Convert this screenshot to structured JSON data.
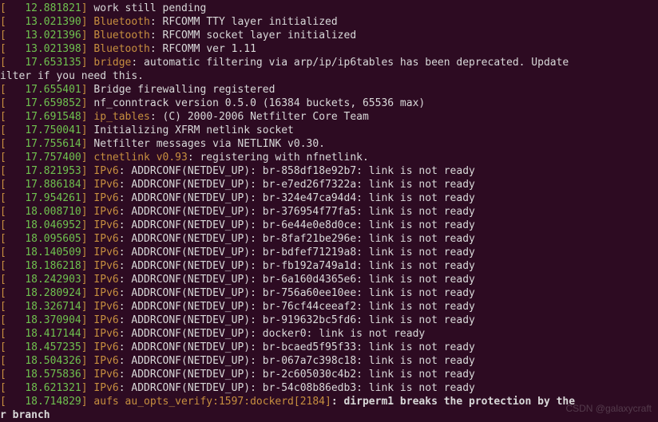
{
  "watermark": "CSDN @galaxycraft",
  "lines": [
    {
      "ts": "12.881821",
      "cat": "",
      "msg": "work still pending"
    },
    {
      "ts": "13.021390",
      "cat": "Bluetooth",
      "msg": ": RFCOMM TTY layer initialized"
    },
    {
      "ts": "13.021396",
      "cat": "Bluetooth",
      "msg": ": RFCOMM socket layer initialized"
    },
    {
      "ts": "13.021398",
      "cat": "Bluetooth",
      "msg": ": RFCOMM ver 1.11"
    },
    {
      "ts": "17.653135",
      "cat": "bridge",
      "msg": ": automatic filtering via arp/ip/ip6tables has been deprecated. Update "
    },
    {
      "wrap": true,
      "msg": "ilter if you need this."
    },
    {
      "ts": "17.655401",
      "cat": "",
      "msg": "Bridge firewalling registered"
    },
    {
      "ts": "17.659852",
      "cat": "",
      "msg": "nf_conntrack version 0.5.0 (16384 buckets, 65536 max)"
    },
    {
      "ts": "17.691548",
      "cat": "ip_tables",
      "msg": ": (C) 2000-2006 Netfilter Core Team"
    },
    {
      "ts": "17.750041",
      "cat": "",
      "msg": "Initializing XFRM netlink socket"
    },
    {
      "ts": "17.755614",
      "cat": "",
      "msg": "Netfilter messages via NETLINK v0.30."
    },
    {
      "ts": "17.757400",
      "cat": "ctnetlink v0.93",
      "msg": ": registering with nfnetlink."
    },
    {
      "ts": "17.821953",
      "cat": "IPv6",
      "msg": ": ADDRCONF(NETDEV_UP): br-858df18e92b7: link is not ready"
    },
    {
      "ts": "17.886184",
      "cat": "IPv6",
      "msg": ": ADDRCONF(NETDEV_UP): br-e7ed26f7322a: link is not ready"
    },
    {
      "ts": "17.954261",
      "cat": "IPv6",
      "msg": ": ADDRCONF(NETDEV_UP): br-324e47ca94d4: link is not ready"
    },
    {
      "ts": "18.008710",
      "cat": "IPv6",
      "msg": ": ADDRCONF(NETDEV_UP): br-376954f77fa5: link is not ready"
    },
    {
      "ts": "18.046952",
      "cat": "IPv6",
      "msg": ": ADDRCONF(NETDEV_UP): br-6e44e0e8d0ce: link is not ready"
    },
    {
      "ts": "18.095605",
      "cat": "IPv6",
      "msg": ": ADDRCONF(NETDEV_UP): br-8faf21be296e: link is not ready"
    },
    {
      "ts": "18.140509",
      "cat": "IPv6",
      "msg": ": ADDRCONF(NETDEV_UP): br-bdfef71219a8: link is not ready"
    },
    {
      "ts": "18.186218",
      "cat": "IPv6",
      "msg": ": ADDRCONF(NETDEV_UP): br-fb192a749a1d: link is not ready"
    },
    {
      "ts": "18.242903",
      "cat": "IPv6",
      "msg": ": ADDRCONF(NETDEV_UP): br-6a160d4365e6: link is not ready"
    },
    {
      "ts": "18.280924",
      "cat": "IPv6",
      "msg": ": ADDRCONF(NETDEV_UP): br-756a60ee10ee: link is not ready"
    },
    {
      "ts": "18.326714",
      "cat": "IPv6",
      "msg": ": ADDRCONF(NETDEV_UP): br-76cf44ceeaf2: link is not ready"
    },
    {
      "ts": "18.370904",
      "cat": "IPv6",
      "msg": ": ADDRCONF(NETDEV_UP): br-919632bc5fd6: link is not ready"
    },
    {
      "ts": "18.417144",
      "cat": "IPv6",
      "msg": ": ADDRCONF(NETDEV_UP): docker0: link is not ready"
    },
    {
      "ts": "18.457235",
      "cat": "IPv6",
      "msg": ": ADDRCONF(NETDEV_UP): br-bcaed5f95f33: link is not ready"
    },
    {
      "ts": "18.504326",
      "cat": "IPv6",
      "msg": ": ADDRCONF(NETDEV_UP): br-067a7c398c18: link is not ready"
    },
    {
      "ts": "18.575836",
      "cat": "IPv6",
      "msg": ": ADDRCONF(NETDEV_UP): br-2c605030c4b2: link is not ready"
    },
    {
      "ts": "18.621321",
      "cat": "IPv6",
      "msg": ": ADDRCONF(NETDEV_UP): br-54c08b86edb3: link is not ready"
    },
    {
      "ts": "18.714829",
      "cat": "aufs au_opts_verify:1597:dockerd[2184]",
      "boldmsg": ": dirperm1 breaks the protection by the"
    },
    {
      "wrap": true,
      "boldmsg": "r branch"
    }
  ]
}
